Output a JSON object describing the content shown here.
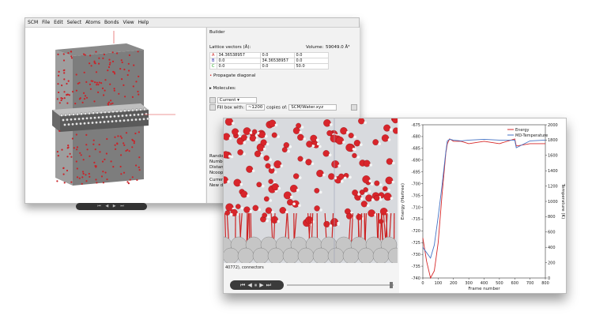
{
  "window1": {
    "menu": [
      "SCM",
      "File",
      "Edit",
      "Select",
      "Atoms",
      "Bonds",
      "View",
      "Help"
    ],
    "panel": {
      "section": "Builder",
      "lattice_label": "Lattice vectors (Å):",
      "volume_label": "Volume:",
      "volume_value": "59049.0 Å³",
      "lattice_rows": [
        {
          "name": "A",
          "v1": "34.36538957",
          "v2": "0.0",
          "v3": "0.0"
        },
        {
          "name": "B",
          "v1": "0.0",
          "v2": "34.36538957",
          "v3": "0.0"
        },
        {
          "name": "C",
          "v1": "0.0",
          "v2": "0.0",
          "v3": "50.0"
        }
      ],
      "propagate": "Propagate diagonal",
      "molecules": "Molecules:",
      "current": "Current",
      "fill_label": "Fill box with:",
      "fill_count": "~1200",
      "copies_of": "copies of:",
      "copies_file": "SCM/Water.xyz",
      "side_labels": [
        "Random",
        "Number",
        "Distanc",
        "Ncoop",
        "Current",
        "New de"
      ]
    }
  },
  "window2": {
    "status": "40772), connectors",
    "chart_data": {
      "type": "line",
      "xlabel": "Frame number",
      "ylabel": "Energy (Hartree)",
      "y2label": "Temperature (K)",
      "xlim": [
        0,
        800
      ],
      "ylim": [
        -740,
        -675
      ],
      "y2lim": [
        0,
        2000
      ],
      "xticks": [
        0,
        100,
        200,
        300,
        400,
        500,
        600,
        700,
        800
      ],
      "yticks": [
        -740,
        -735,
        -730,
        -725,
        -720,
        -715,
        -710,
        -705,
        -700,
        -695,
        -690,
        -685,
        -680,
        -675
      ],
      "y2ticks": [
        0,
        200,
        400,
        600,
        800,
        1000,
        1200,
        1400,
        1600,
        1800,
        2000
      ],
      "legend_position": "top-right",
      "series": [
        {
          "name": "Energy",
          "axis": "left",
          "color": "#d62728",
          "x": [
            0,
            25,
            50,
            75,
            100,
            125,
            150,
            160,
            175,
            200,
            250,
            300,
            400,
            500,
            600,
            610,
            700,
            800
          ],
          "y": [
            -723,
            -733,
            -740,
            -737,
            -725,
            -705,
            -687,
            -683,
            -681,
            -682,
            -682,
            -683,
            -682,
            -683,
            -681,
            -684,
            -683,
            -683
          ]
        },
        {
          "name": "MD-Temperature",
          "axis": "right",
          "color": "#4472c4",
          "x": [
            0,
            25,
            50,
            75,
            100,
            125,
            150,
            160,
            175,
            200,
            250,
            300,
            400,
            500,
            600,
            610,
            700,
            800
          ],
          "y": [
            400,
            330,
            260,
            430,
            800,
            1200,
            1650,
            1790,
            1810,
            1800,
            1790,
            1800,
            1810,
            1800,
            1800,
            1700,
            1790,
            1800
          ]
        }
      ]
    }
  }
}
